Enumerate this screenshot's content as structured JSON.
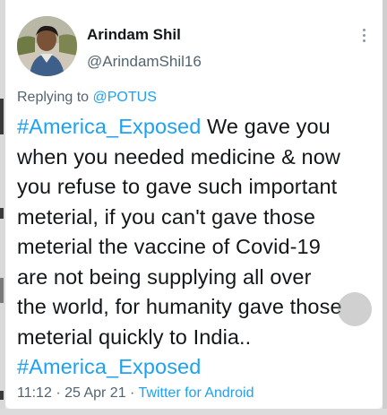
{
  "colors": {
    "link": "#1da1f2",
    "text": "#14171a",
    "secondary": "#536471",
    "card_bg": "#ffffff"
  },
  "tweet": {
    "author_name": "Arindam Shil",
    "author_handle": "@ArindamShil16",
    "replying_to_label": "Replying to",
    "replying_to_handle": "@POTUS",
    "lines": [
      {
        "hashtag": "#America_Exposed",
        "text": " We gave you"
      },
      {
        "text": "when you needed medicine & now"
      },
      {
        "text": "you refuse to gave such important"
      },
      {
        "text": "meterial, if you can't gave those"
      },
      {
        "text": "meterial the vaccine of Covid-19"
      },
      {
        "text": "are not being supplying all over"
      },
      {
        "text": "the world, for humanity gave those"
      },
      {
        "text": "meterial quickly to India.."
      },
      {
        "hashtag": "#America_Exposed"
      }
    ],
    "time": "11:12",
    "separator": "·",
    "date": "25 Apr 21",
    "source": "Twitter for Android"
  },
  "icons": {
    "avatar": "profile-photo",
    "more": "more-vertical-icon"
  }
}
